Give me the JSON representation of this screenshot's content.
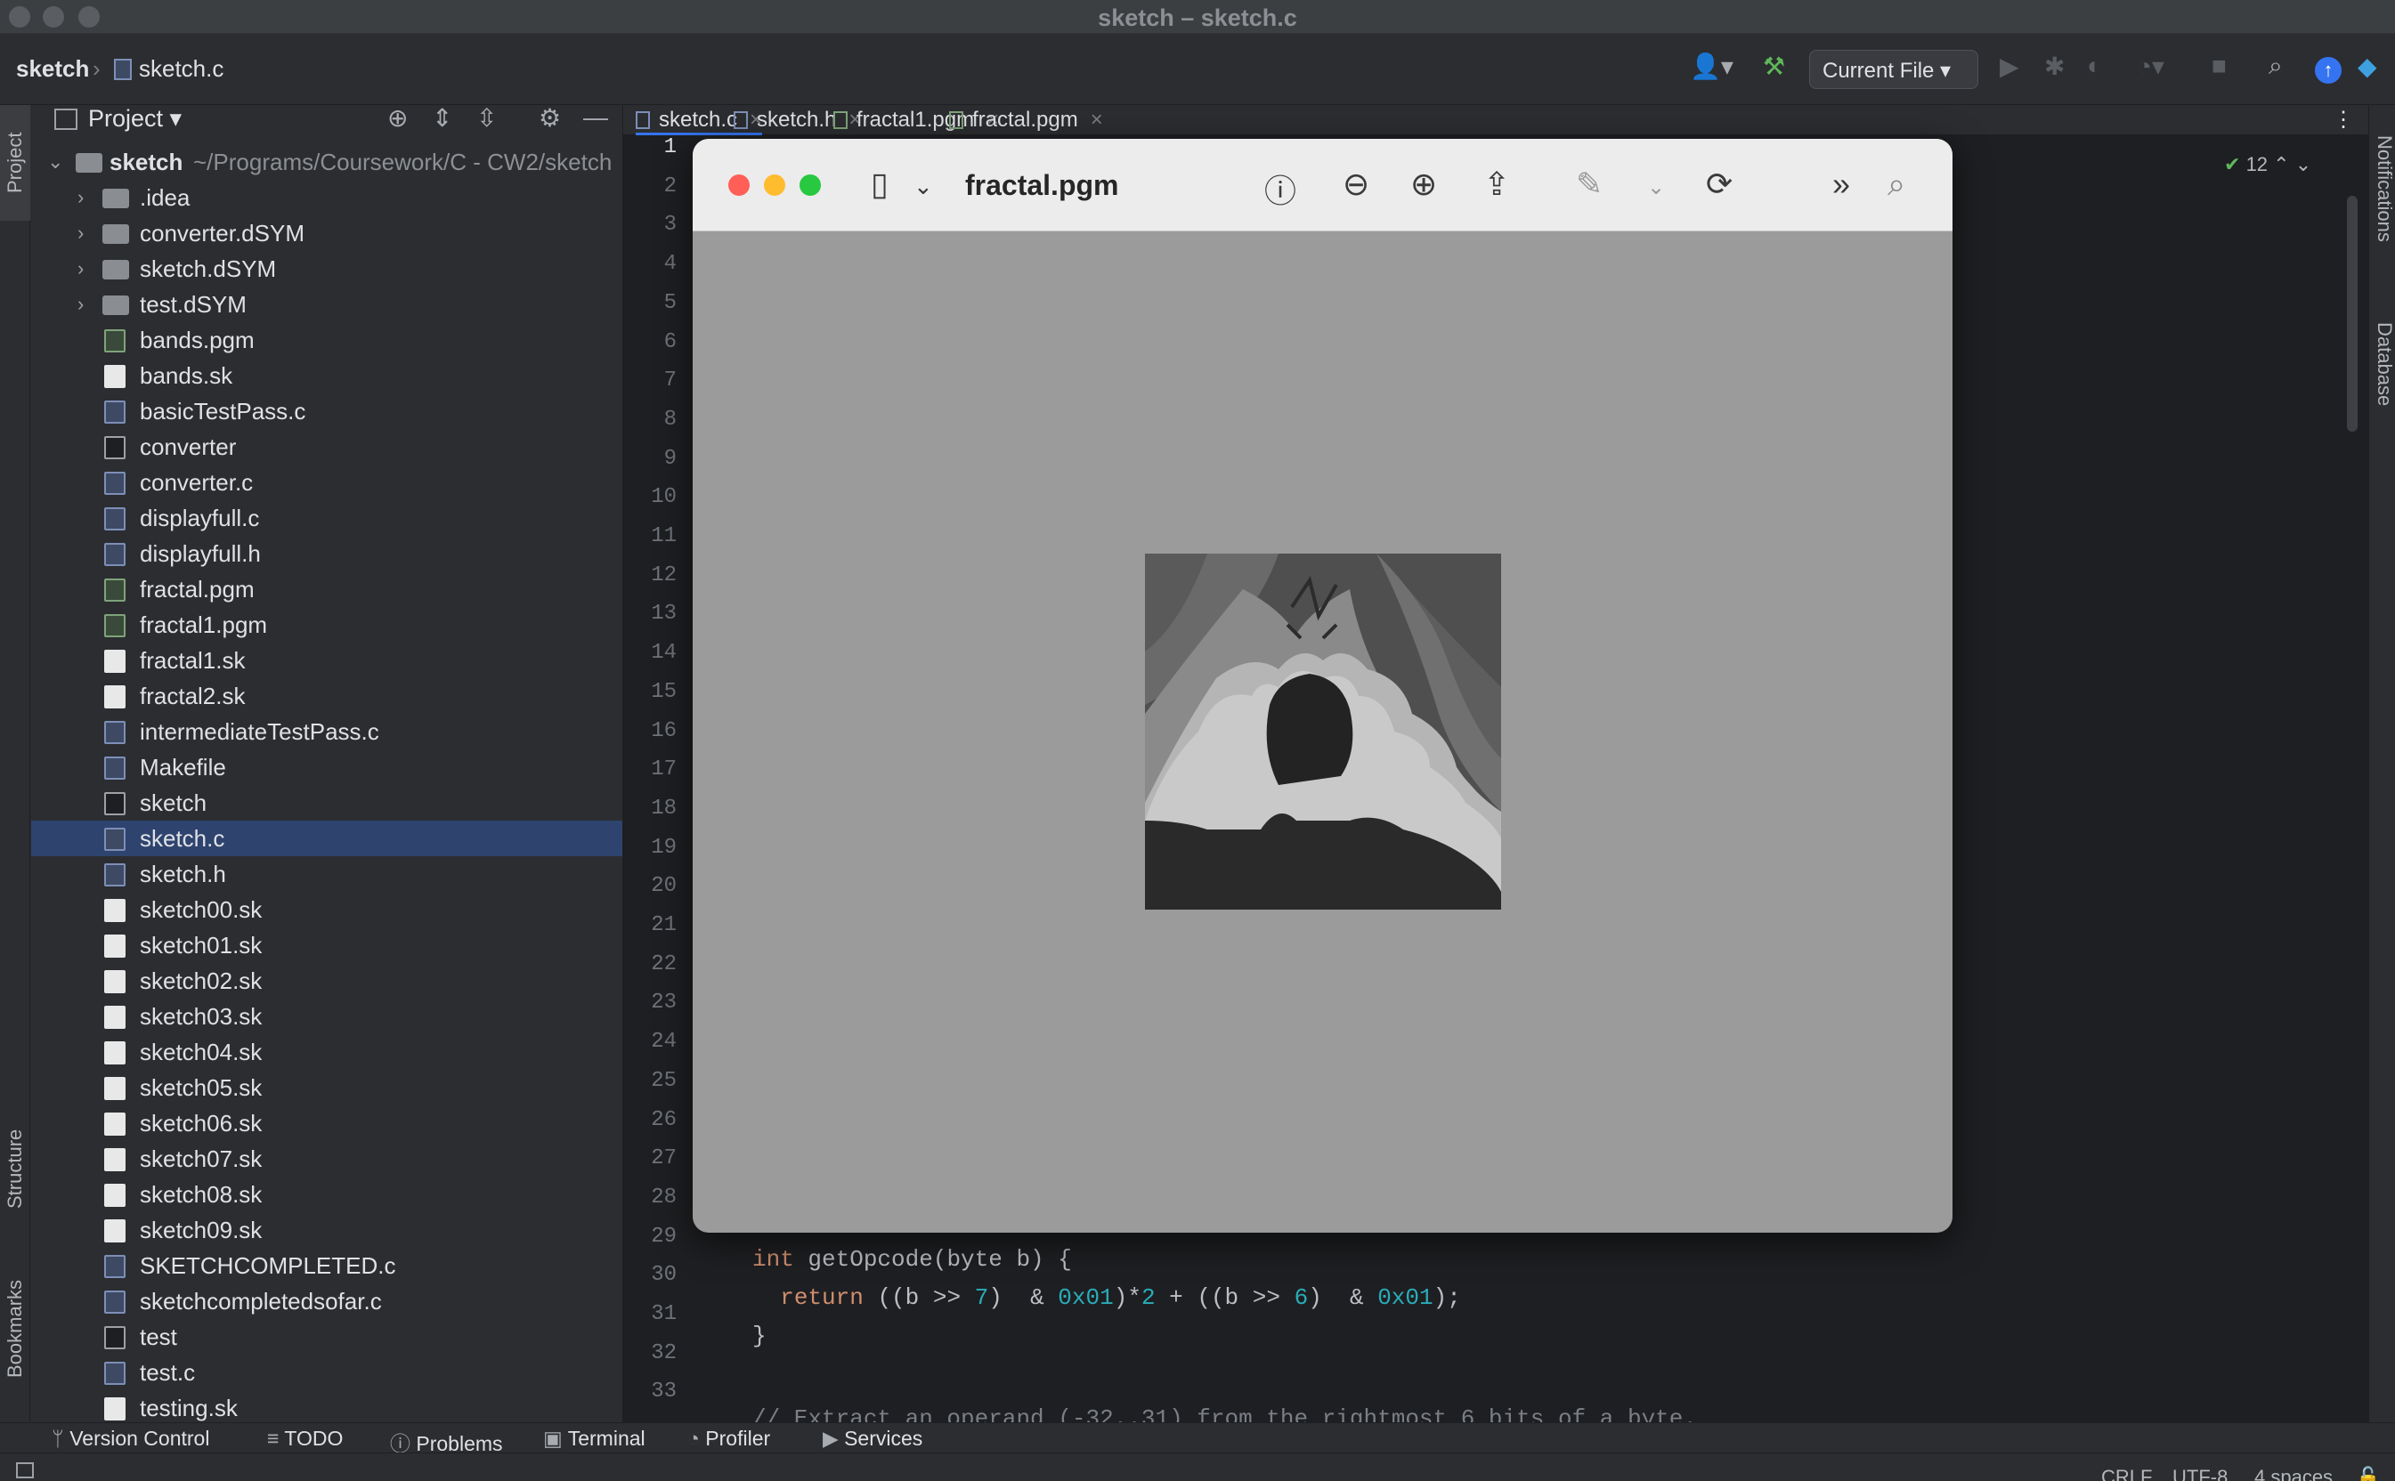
{
  "window": {
    "title": "sketch – sketch.c"
  },
  "breadcrumb": {
    "project": "sketch",
    "file": "sketch.c"
  },
  "toolbar": {
    "run_config": "Current File"
  },
  "project_panel": {
    "title": "Project",
    "root": {
      "name": "sketch",
      "path": "~/Programs/Coursework/C - CW2/sketch"
    },
    "items": [
      {
        "label": "bands.pgm",
        "type": "pgm"
      },
      {
        "label": "bands.sk",
        "type": "file"
      },
      {
        "label": "basicTestPass.c",
        "type": "c"
      },
      {
        "label": "converter",
        "type": "exe"
      },
      {
        "label": "converter.c",
        "type": "c"
      },
      {
        "label": "displayfull.c",
        "type": "c"
      },
      {
        "label": "displayfull.h",
        "type": "c"
      },
      {
        "label": "fractal.pgm",
        "type": "pgm"
      },
      {
        "label": "fractal1.pgm",
        "type": "pgm"
      },
      {
        "label": "fractal1.sk",
        "type": "file"
      },
      {
        "label": "fractal2.sk",
        "type": "file"
      },
      {
        "label": "intermediateTestPass.c",
        "type": "c"
      },
      {
        "label": "Makefile",
        "type": "c"
      },
      {
        "label": "sketch",
        "type": "exe"
      },
      {
        "label": "sketch.c",
        "type": "c"
      },
      {
        "label": "sketch.h",
        "type": "c"
      },
      {
        "label": "sketch00.sk",
        "type": "file"
      },
      {
        "label": "sketch01.sk",
        "type": "file"
      },
      {
        "label": "sketch02.sk",
        "type": "file"
      },
      {
        "label": "sketch03.sk",
        "type": "file"
      },
      {
        "label": "sketch04.sk",
        "type": "file"
      },
      {
        "label": "sketch05.sk",
        "type": "file"
      },
      {
        "label": "sketch06.sk",
        "type": "file"
      },
      {
        "label": "sketch07.sk",
        "type": "file"
      },
      {
        "label": "sketch08.sk",
        "type": "file"
      },
      {
        "label": "sketch09.sk",
        "type": "file"
      },
      {
        "label": "SKETCHCOMPLETED.c",
        "type": "c"
      },
      {
        "label": "sketchcompletedsofar.c",
        "type": "c"
      },
      {
        "label": "test",
        "type": "exe"
      },
      {
        "label": "test.c",
        "type": "c"
      },
      {
        "label": "testing.sk",
        "type": "file"
      }
    ],
    "folders": [
      ".idea",
      "converter.dSYM",
      "sketch.dSYM",
      "test.dSYM"
    ],
    "selected": "sketch.c"
  },
  "tabs": [
    {
      "label": "sketch.c",
      "active": true
    },
    {
      "label": "sketch.h",
      "active": false
    },
    {
      "label": "fractal1.pgm",
      "active": false
    },
    {
      "label": "fractal.pgm",
      "active": false
    }
  ],
  "editor": {
    "line_numbers": [
      "1",
      "2",
      "3",
      "4",
      "5",
      "6",
      "7",
      "8",
      "9",
      "10",
      "11",
      "12",
      "13",
      "14",
      "15",
      "16",
      "17",
      "18",
      "19",
      "20",
      "21",
      "22",
      "23",
      "24",
      "25",
      "26",
      "27",
      "28",
      "29",
      "30",
      "31",
      "32",
      "33"
    ],
    "inspection_count": "12",
    "code": {
      "l29_kw": "int",
      "l29_rest": " getOpcode(byte b) {",
      "l30_kw": "return",
      "l30_a": " ((b >> ",
      "l30_n1": "7",
      "l30_b": ")  & ",
      "l30_n2": "0x01",
      "l30_c": ")*",
      "l30_n3": "2",
      "l30_d": " + ((b >> ",
      "l30_n4": "6",
      "l30_e": ")  & ",
      "l30_n5": "0x01",
      "l30_f": ");",
      "l31": "}",
      "l33": "// Extract an operand (-32..31) from the rightmost 6 bits of a byte."
    }
  },
  "side_tabs": {
    "left_top": "Project",
    "left_structure": "Structure",
    "left_bookmarks": "Bookmarks",
    "right_notifications": "Notifications",
    "right_database": "Database"
  },
  "bottom_tools": [
    "Version Control",
    "TODO",
    "Problems",
    "Terminal",
    "Profiler",
    "Services"
  ],
  "status": {
    "line_sep": "CRLF",
    "encoding": "UTF-8",
    "indent": "4 spaces"
  },
  "preview": {
    "title": "fractal.pgm"
  }
}
